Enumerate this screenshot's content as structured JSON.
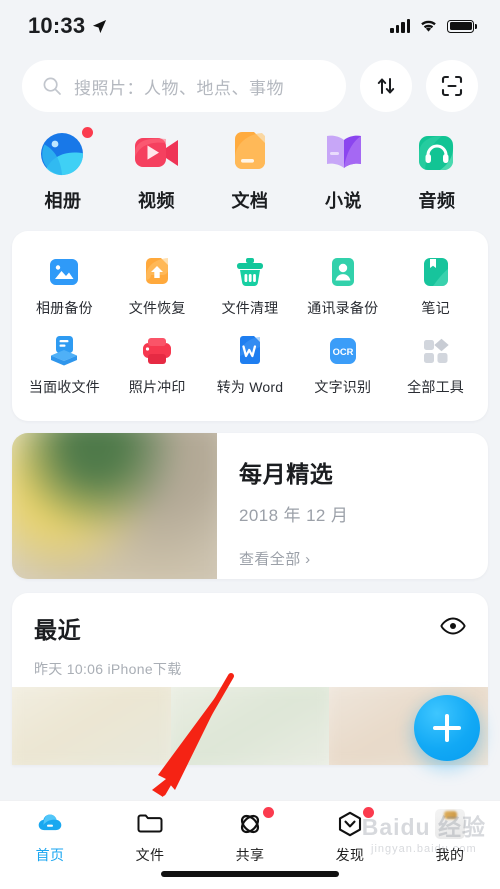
{
  "status_bar": {
    "time": "10:33",
    "location_icon": "location-arrow-icon",
    "signal_icon": "cellular-signal-icon",
    "wifi_icon": "wifi-icon",
    "battery_icon": "battery-icon"
  },
  "search": {
    "placeholder": "搜照片：人物、地点、事物",
    "icon": "search-icon",
    "sort_icon": "sort-arrows-icon",
    "scan_icon": "scan-code-icon"
  },
  "categories": [
    {
      "label": "相册",
      "icon": "photo-album-icon",
      "badge": true,
      "color": "#1a8ef0"
    },
    {
      "label": "视频",
      "icon": "video-camera-icon",
      "badge": false,
      "color": "#f5405f"
    },
    {
      "label": "文档",
      "icon": "document-icon",
      "badge": false,
      "color": "#ffab3f"
    },
    {
      "label": "小说",
      "icon": "book-icon",
      "badge": false,
      "color": "#a16cf0"
    },
    {
      "label": "音频",
      "icon": "headphones-icon",
      "badge": false,
      "color": "#18c99a"
    }
  ],
  "tools": {
    "rows": [
      [
        {
          "label": "相册备份",
          "icon": "image-backup-icon",
          "color": "#1e8ef5"
        },
        {
          "label": "文件恢复",
          "icon": "file-restore-icon",
          "color": "#ffa93c"
        },
        {
          "label": "文件清理",
          "icon": "trash-clean-icon",
          "color": "#1ccfa0"
        },
        {
          "label": "通讯录备份",
          "icon": "contacts-backup-icon",
          "color": "#1fcba2"
        },
        {
          "label": "笔记",
          "icon": "notes-icon",
          "color": "#17c49c"
        }
      ],
      [
        {
          "label": "当面收文件",
          "icon": "receive-file-icon",
          "color": "#2e9bf2"
        },
        {
          "label": "照片冲印",
          "icon": "photo-print-icon",
          "color": "#f6384f"
        },
        {
          "label": "转为 Word",
          "icon": "word-convert-icon",
          "color": "#1f7ef0"
        },
        {
          "label": "文字识别",
          "icon": "ocr-icon",
          "color": "#2a93f5"
        },
        {
          "label": "全部工具",
          "icon": "all-tools-grid-icon",
          "color": "#cfd3da"
        }
      ]
    ]
  },
  "featured": {
    "title": "每月精选",
    "subtitle": "2018 年 12 月",
    "link": "查看全部 ›",
    "thumb_alt": "featured-photo-thumbnail"
  },
  "recent": {
    "title": "最近",
    "eye_icon": "eye-icon",
    "meta": "昨天 10:06 iPhone下载",
    "thumbs": [
      "recent-photo-1",
      "recent-photo-2",
      "recent-photo-3"
    ]
  },
  "fab": {
    "icon": "plus-icon",
    "color": "#12a9f5"
  },
  "tabbar": [
    {
      "label": "首页",
      "icon": "cloud-home-icon",
      "active": true,
      "badge": false
    },
    {
      "label": "文件",
      "icon": "folder-icon",
      "active": false,
      "badge": false
    },
    {
      "label": "共享",
      "icon": "share-atom-icon",
      "active": false,
      "badge": true
    },
    {
      "label": "发现",
      "icon": "discover-icon",
      "active": false,
      "badge": true
    },
    {
      "label": "我的",
      "icon": "user-avatar",
      "active": false,
      "badge": false
    }
  ],
  "annotation": {
    "type": "red-arrow",
    "color": "#f52314"
  },
  "watermark": {
    "main": "Baidu 经验",
    "sub": "jingyan.baidu.com"
  }
}
